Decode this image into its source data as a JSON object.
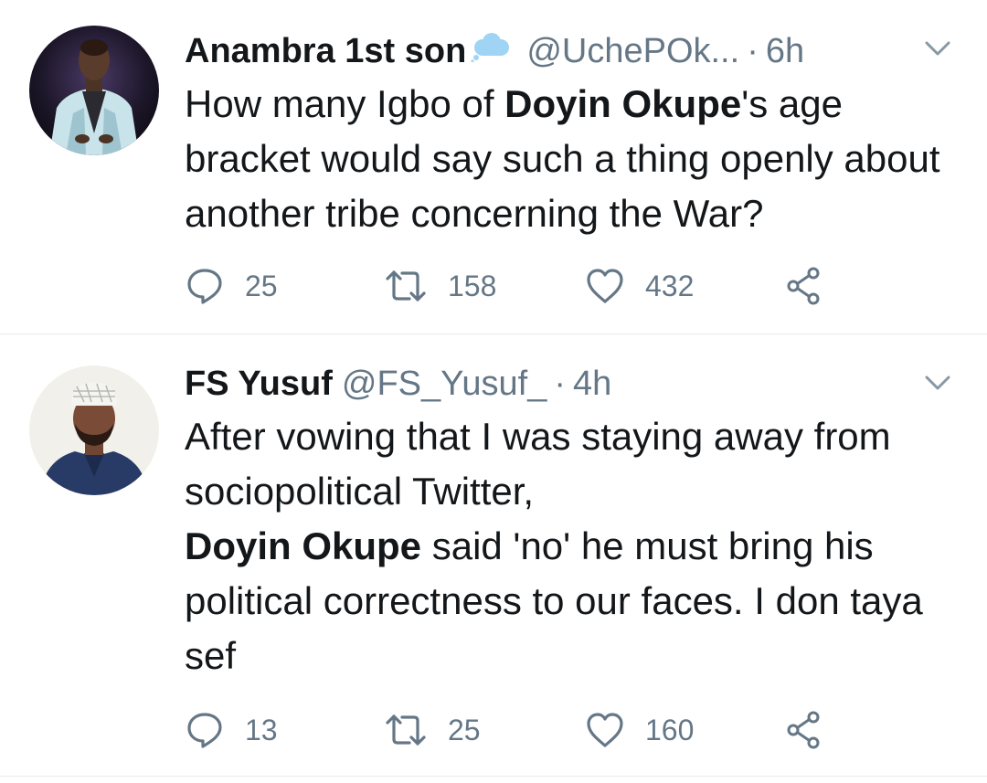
{
  "colors": {
    "text_primary": "#14171a",
    "text_secondary": "#657786",
    "divider": "#e6ecf0",
    "cloud_emoji": "#9fd4f5"
  },
  "tweets": [
    {
      "display_name": "Anambra 1st son",
      "name_emoji": "cloud-icon",
      "handle": "@UchePOk...",
      "separator": "·",
      "time": "6h",
      "text": {
        "p1": "How many Igbo of ",
        "b1": "Doyin Okupe",
        "p2": "'s age bracket would say such a thing openly about another tribe concerning the War?"
      },
      "replies": "25",
      "retweets": "158",
      "likes": "432"
    },
    {
      "display_name": "FS Yusuf",
      "handle": "@FS_Yusuf_",
      "separator": "·",
      "time": "4h",
      "text": {
        "p1": "After vowing that I was staying away from sociopolitical Twitter,",
        "b1": "Doyin Okupe",
        "p2": " said 'no' he must bring his political correctness to our faces. I don taya sef"
      },
      "replies": "13",
      "retweets": "25",
      "likes": "160"
    }
  ]
}
